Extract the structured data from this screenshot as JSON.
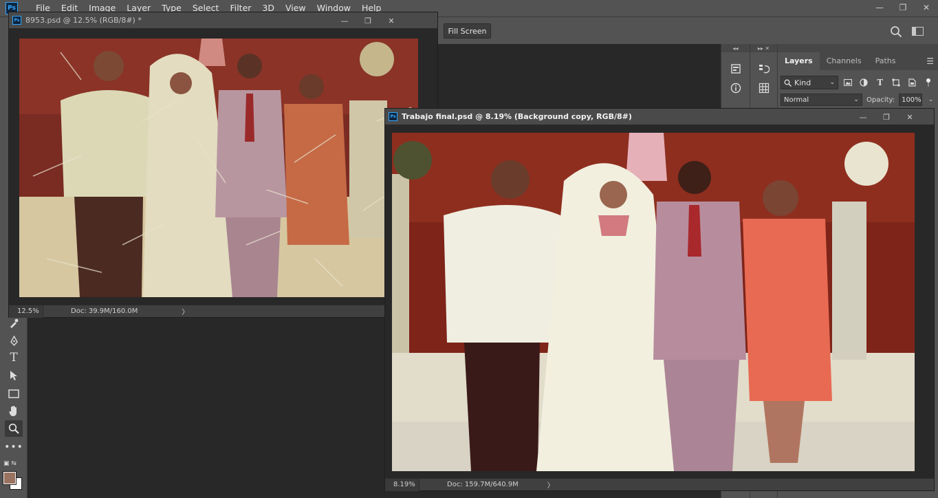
{
  "app": {
    "logo_text": "Ps"
  },
  "menu": {
    "items": [
      "File",
      "Edit",
      "Image",
      "Layer",
      "Type",
      "Select",
      "Filter",
      "3D",
      "View",
      "Window",
      "Help"
    ]
  },
  "window_controls": {
    "minimize": "—",
    "restore": "❐",
    "close": "✕"
  },
  "options_bar": {
    "fill_screen_label": "Fill Screen"
  },
  "documents": [
    {
      "title": "8953.psd @ 12.5% (RGB/8#) *",
      "zoom": "12.5%",
      "doc_info": "Doc: 39.9M/160.0M",
      "arrow": "〉"
    },
    {
      "title": "Trabajo final.psd @ 8.19% (Background copy, RGB/8#)",
      "zoom": "8.19%",
      "doc_info": "Doc: 159.7M/640.9M",
      "arrow": "〉"
    }
  ],
  "layers_panel": {
    "tabs": [
      "Layers",
      "Channels",
      "Paths"
    ],
    "active_tab": "Layers",
    "kind_label": "Kind",
    "blend_mode": "Normal",
    "opacity_label": "Opacity:",
    "opacity_value": "100%"
  },
  "colors": {
    "foreground": "#9a7360",
    "background": "#ffffff",
    "accent": "#31a8ff"
  }
}
